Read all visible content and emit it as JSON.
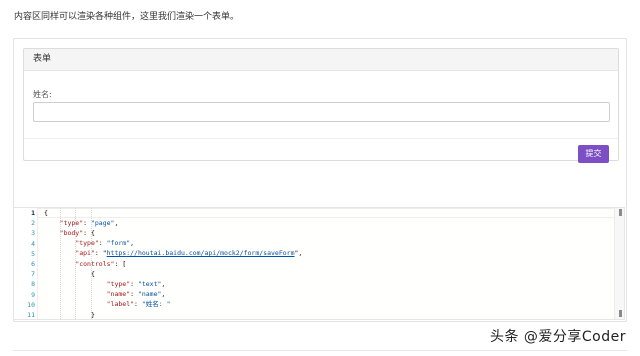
{
  "intro_text": "内容区同样可以渲染各种组件，这里我们渲染一个表单。",
  "form": {
    "title": "表单",
    "field_label": "姓名:",
    "field_value": "",
    "submit_label": "提交"
  },
  "editor": {
    "lines": [
      {
        "n": "1",
        "segs": [
          {
            "t": "{",
            "c": "p"
          }
        ]
      },
      {
        "n": "2",
        "segs": [
          {
            "t": "    ",
            "c": "p"
          },
          {
            "t": "\"type\"",
            "c": "k"
          },
          {
            "t": ": ",
            "c": "p"
          },
          {
            "t": "\"page\"",
            "c": "s"
          },
          {
            "t": ",",
            "c": "p"
          }
        ]
      },
      {
        "n": "3",
        "segs": [
          {
            "t": "    ",
            "c": "p"
          },
          {
            "t": "\"body\"",
            "c": "k"
          },
          {
            "t": ": {",
            "c": "p"
          }
        ]
      },
      {
        "n": "4",
        "segs": [
          {
            "t": "        ",
            "c": "p"
          },
          {
            "t": "\"type\"",
            "c": "k"
          },
          {
            "t": ": ",
            "c": "p"
          },
          {
            "t": "\"form\"",
            "c": "s"
          },
          {
            "t": ",",
            "c": "p"
          }
        ]
      },
      {
        "n": "5",
        "segs": [
          {
            "t": "        ",
            "c": "p"
          },
          {
            "t": "\"api\"",
            "c": "k"
          },
          {
            "t": ": \"",
            "c": "p"
          },
          {
            "t": "https://houtai.baidu.com/api/mock2/form/saveForm",
            "c": "u"
          },
          {
            "t": "\",",
            "c": "p"
          }
        ]
      },
      {
        "n": "6",
        "segs": [
          {
            "t": "        ",
            "c": "p"
          },
          {
            "t": "\"controls\"",
            "c": "k"
          },
          {
            "t": ": [",
            "c": "p"
          }
        ]
      },
      {
        "n": "7",
        "segs": [
          {
            "t": "            {",
            "c": "p"
          }
        ]
      },
      {
        "n": "8",
        "segs": [
          {
            "t": "                ",
            "c": "p"
          },
          {
            "t": "\"type\"",
            "c": "k"
          },
          {
            "t": ": ",
            "c": "p"
          },
          {
            "t": "\"text\"",
            "c": "s"
          },
          {
            "t": ",",
            "c": "p"
          }
        ]
      },
      {
        "n": "9",
        "segs": [
          {
            "t": "                ",
            "c": "p"
          },
          {
            "t": "\"name\"",
            "c": "k"
          },
          {
            "t": ": ",
            "c": "p"
          },
          {
            "t": "\"name\"",
            "c": "s"
          },
          {
            "t": ",",
            "c": "p"
          }
        ]
      },
      {
        "n": "10",
        "segs": [
          {
            "t": "                ",
            "c": "p"
          },
          {
            "t": "\"label\"",
            "c": "k"
          },
          {
            "t": ": ",
            "c": "p"
          },
          {
            "t": "\"姓名: \"",
            "c": "s"
          }
        ]
      },
      {
        "n": "11",
        "segs": [
          {
            "t": "            }",
            "c": "p"
          }
        ]
      }
    ]
  },
  "watermark": "头条 @爱分享Coder"
}
